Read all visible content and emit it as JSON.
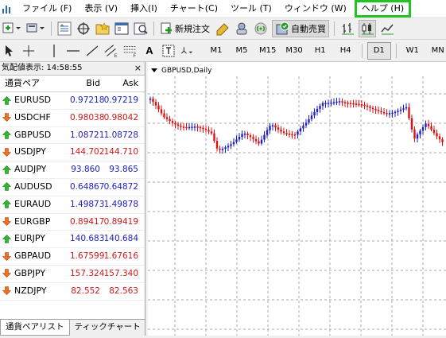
{
  "menu": {
    "items": [
      {
        "label": "ファイル (F)",
        "name": "menu-file"
      },
      {
        "label": "表示 (V)",
        "name": "menu-view"
      },
      {
        "label": "挿入(I)",
        "name": "menu-insert"
      },
      {
        "label": "チャート(C)",
        "name": "menu-chart"
      },
      {
        "label": "ツール (T)",
        "name": "menu-tools"
      },
      {
        "label": "ウィンドウ (W)",
        "name": "menu-window"
      }
    ],
    "help_label": "ヘルプ (H)",
    "highlight_color": "#22c422"
  },
  "toolbar": {
    "new_order_label": "新規注文",
    "autotrade_label": "自動売買"
  },
  "toolbar2": {
    "timeframes": [
      "M1",
      "M5",
      "M15",
      "M30",
      "H1",
      "H4",
      "D1",
      "W1",
      "MN"
    ],
    "active_timeframe": "D1"
  },
  "market_watch": {
    "title": "気配値表示: 14:58:55",
    "close_glyph": "×",
    "col_symbol": "通貨ペア",
    "col_bid": "Bid",
    "col_ask": "Ask",
    "rows": [
      {
        "symbol": "EURUSD",
        "bid": "0.97218",
        "ask": "0.97219",
        "dir": "up"
      },
      {
        "symbol": "USDCHF",
        "bid": "0.98038",
        "ask": "0.98042",
        "dir": "down"
      },
      {
        "symbol": "GBPUSD",
        "bid": "1.08721",
        "ask": "1.08728",
        "dir": "up"
      },
      {
        "symbol": "USDJPY",
        "bid": "144.702",
        "ask": "144.710",
        "dir": "down"
      },
      {
        "symbol": "AUDJPY",
        "bid": "93.860",
        "ask": "93.865",
        "dir": "up"
      },
      {
        "symbol": "AUDUSD",
        "bid": "0.64867",
        "ask": "0.64872",
        "dir": "up"
      },
      {
        "symbol": "EURAUD",
        "bid": "1.49873",
        "ask": "1.49878",
        "dir": "up"
      },
      {
        "symbol": "EURGBP",
        "bid": "0.89417",
        "ask": "0.89419",
        "dir": "down"
      },
      {
        "symbol": "EURJPY",
        "bid": "140.683",
        "ask": "140.684",
        "dir": "up"
      },
      {
        "symbol": "GBPAUD",
        "bid": "1.67599",
        "ask": "1.67616",
        "dir": "down"
      },
      {
        "symbol": "GBPJPY",
        "bid": "157.324",
        "ask": "157.340",
        "dir": "down"
      },
      {
        "symbol": "NZDJPY",
        "bid": "82.552",
        "ask": "82.563",
        "dir": "down"
      }
    ],
    "tabs": [
      "通貨ペアリスト",
      "ティックチャート"
    ],
    "active_tab": 0,
    "up_color": "#2020c0",
    "down_color": "#d01818"
  },
  "chart": {
    "title": "GBPUSD,Daily",
    "bull_color": "#1f1fd0",
    "bear_color": "#e01010",
    "grid": true
  }
}
